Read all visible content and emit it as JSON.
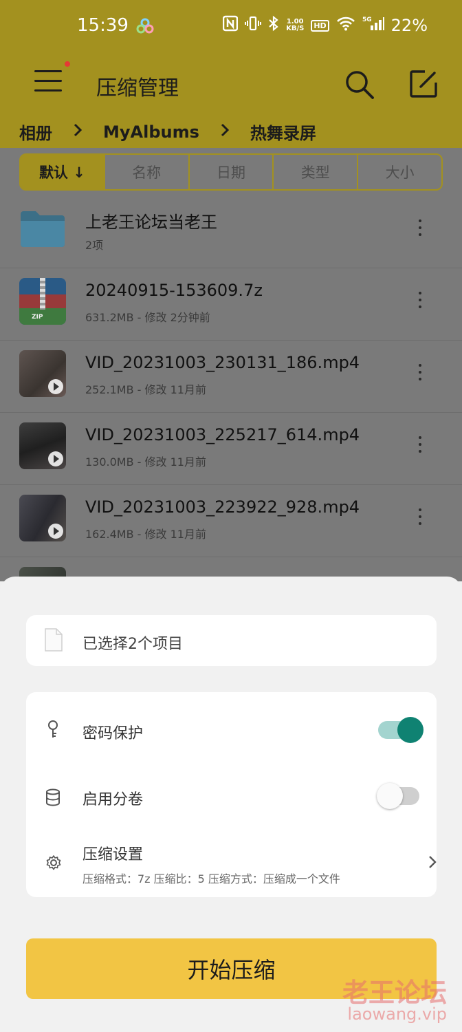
{
  "status_bar": {
    "time": "15:39",
    "net_speed_top": "1.00",
    "net_speed_unit": "KB/S",
    "hd_label": "HD",
    "network_label": "5G",
    "battery": "22%",
    "icons": [
      "nfc-icon",
      "vibrate-icon",
      "bluetooth-icon",
      "wifi-icon",
      "signal-icon"
    ]
  },
  "header": {
    "title": "压缩管理",
    "colors": {
      "bar": "#a3911f"
    }
  },
  "breadcrumb": [
    "相册",
    "MyAlbums",
    "热舞录屏"
  ],
  "sort_tabs": [
    "默认 ↓",
    "名称",
    "日期",
    "类型",
    "大小"
  ],
  "files": [
    {
      "name": "上老王论坛当老王",
      "meta": "2项",
      "icon": "folder-icon"
    },
    {
      "name": "20240915-153609.7z",
      "meta": "631.2MB - 修改 2分钟前",
      "icon": "zip-archive-icon",
      "badge": "ZIP"
    },
    {
      "name": "VID_20231003_230131_186.mp4",
      "meta": "252.1MB - 修改 11月前",
      "icon": "video-thumbnail"
    },
    {
      "name": "VID_20231003_225217_614.mp4",
      "meta": "130.0MB - 修改 11月前",
      "icon": "video-thumbnail"
    },
    {
      "name": "VID_20231003_223922_928.mp4",
      "meta": "162.4MB - 修改 11月前",
      "icon": "video-thumbnail"
    }
  ],
  "sheet": {
    "selected_text": "已选择2个项目",
    "options": {
      "password": {
        "label": "密码保护",
        "enabled": true
      },
      "split": {
        "label": "启用分卷",
        "enabled": false
      },
      "settings": {
        "label": "压缩设置",
        "summary": "压缩格式：7z  压缩比：5  压缩方式：压缩成一个文件"
      }
    },
    "start_button": "开始压缩",
    "colors": {
      "toggle_on": "#0f8272",
      "button": "#f2c544"
    }
  },
  "watermark": {
    "line1": "老王论坛",
    "line2": "laowang.vip"
  }
}
